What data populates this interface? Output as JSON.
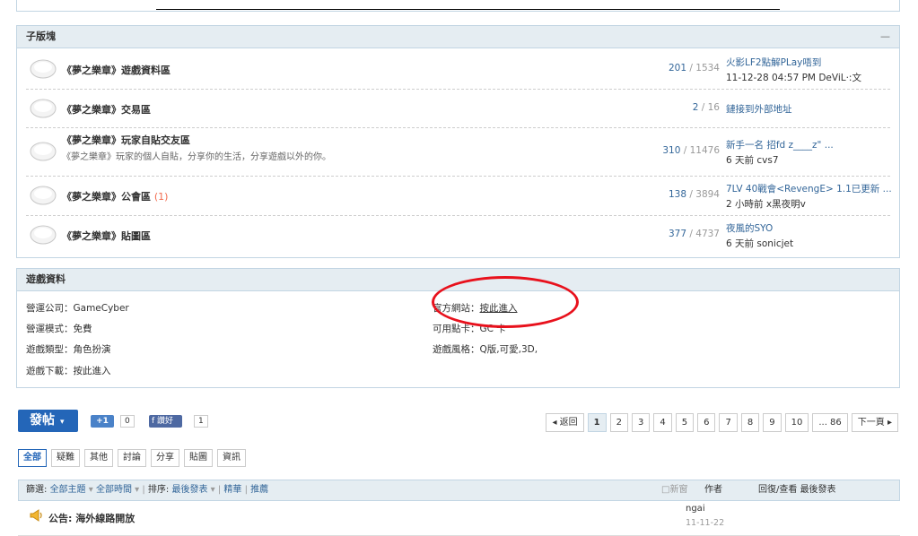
{
  "subforums": {
    "header": "子版塊",
    "collapse": "—",
    "rows": [
      {
        "name": "《夢之樂章》遊戲資料區",
        "count": "",
        "desc": "",
        "threads": "201",
        "posts": "1534",
        "last_title": "火影LF2點解PLay唔到",
        "last_meta": "11-12-28 04:57 PM DeViL·:文"
      },
      {
        "name": "《夢之樂章》交易區",
        "count": "",
        "desc": "",
        "threads": "2",
        "posts": "16",
        "last_title": "鏈接到外部地址",
        "last_meta": ""
      },
      {
        "name": "《夢之樂章》玩家自貼交友區",
        "count": "",
        "desc": "《夢之樂章》玩家的個人自貼，分享你的生活，分享遊戲以外的你。",
        "threads": "310",
        "posts": "11476",
        "last_title": "新手一名 招fd z____z\" ...",
        "last_meta": "6 天前 cvs7"
      },
      {
        "name": "《夢之樂章》公會區",
        "count": "(1)",
        "desc": "",
        "threads": "138",
        "posts": "3894",
        "last_title": "7LV 40戰會<RevengE> 1.1已更新 ...",
        "last_meta": "2 小時前 x黑夜明v"
      },
      {
        "name": "《夢之樂章》貼圖區",
        "count": "",
        "desc": "",
        "threads": "377",
        "posts": "4737",
        "last_title": "夜風的SYO",
        "last_meta": "6 天前 sonicjet"
      }
    ]
  },
  "gameinfo": {
    "header": "遊戲資料",
    "company": "營運公司：GameCyber",
    "mode": "營運模式：免費",
    "type": "遊戲類型：角色扮演",
    "download": "遊戲下載：按此進入",
    "site_label": "官方網站：",
    "site_link": "按此進入",
    "card": "可用點卡：GC 卡",
    "style": "遊戲風格：Q版,可愛,3D,"
  },
  "toolbar": {
    "post_label": "發帖",
    "gplus": "+1",
    "gplus_count": "0",
    "fb_like": "讚好",
    "fb_count": "1"
  },
  "pager": [
    "◂ 返回",
    "1",
    "2",
    "3",
    "4",
    "5",
    "6",
    "7",
    "8",
    "9",
    "10",
    "... 86",
    "下一頁 ▸"
  ],
  "tabs": [
    "全部",
    "疑難",
    "其他",
    "討論",
    "分享",
    "貼圖",
    "資訊"
  ],
  "filter": {
    "label": "篩選:",
    "all_topics": "全部主題",
    "all_time": "全部時間",
    "sort_label": "排序:",
    "sort_value": "最後發表",
    "digest": "精華",
    "recommend": "推薦",
    "new_window": "新窗",
    "author": "作者",
    "reply_view": "回復/查看",
    "last_post": "最後發表"
  },
  "thread": {
    "title": "公告: 海外線路開放",
    "author": "ngai",
    "date": "11-11-22"
  },
  "colors": {
    "accent": "#2466b8",
    "header_bg": "#e5edf2",
    "link": "#336699",
    "highlight": "#e8111c"
  }
}
